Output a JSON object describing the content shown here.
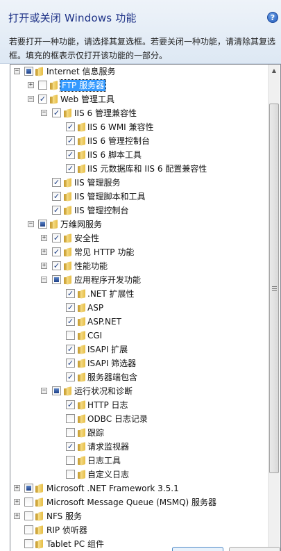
{
  "window": {
    "title": "打开或关闭 Windows 功能",
    "help_glyph": "?",
    "description": "若要打开一种功能，请选择其复选框。若要关闭一种功能，请清除其复选框。填充的框表示仅打开该功能的一部分。"
  },
  "glyphs": {
    "collapse": "−",
    "expand": "+",
    "check": "✓",
    "scroll_up": "▲"
  },
  "tree": {
    "items": [
      {
        "label": "Internet 信息服务",
        "state": "partial",
        "expander": "collapse"
      },
      {
        "label": "FTP 服务器",
        "state": "unchecked",
        "expander": "expand"
      },
      {
        "label": "Web 管理工具",
        "state": "checked",
        "expander": "collapse"
      },
      {
        "label": "IIS 6 管理兼容性",
        "state": "checked",
        "expander": "collapse"
      },
      {
        "label": "IIS 6 WMI 兼容性",
        "state": "checked"
      },
      {
        "label": "IIS 6 管理控制台",
        "state": "checked"
      },
      {
        "label": "IIS 6 脚本工具",
        "state": "checked"
      },
      {
        "label": "IIS 元数据库和 IIS 6 配置兼容性",
        "state": "checked"
      },
      {
        "label": "IIS 管理服务",
        "state": "checked"
      },
      {
        "label": "IIS 管理脚本和工具",
        "state": "checked"
      },
      {
        "label": "IIS 管理控制台",
        "state": "checked"
      },
      {
        "label": "万维网服务",
        "state": "partial",
        "expander": "collapse"
      },
      {
        "label": "安全性",
        "state": "checked",
        "expander": "expand"
      },
      {
        "label": "常见 HTTP 功能",
        "state": "checked",
        "expander": "expand"
      },
      {
        "label": "性能功能",
        "state": "checked",
        "expander": "expand"
      },
      {
        "label": "应用程序开发功能",
        "state": "partial",
        "expander": "collapse"
      },
      {
        "label": ".NET 扩展性",
        "state": "checked"
      },
      {
        "label": "ASP",
        "state": "checked"
      },
      {
        "label": "ASP.NET",
        "state": "checked"
      },
      {
        "label": "CGI",
        "state": "unchecked"
      },
      {
        "label": "ISAPI 扩展",
        "state": "checked"
      },
      {
        "label": "ISAPI 筛选器",
        "state": "checked"
      },
      {
        "label": "服务器端包含",
        "state": "checked"
      },
      {
        "label": "运行状况和诊断",
        "state": "partial",
        "expander": "collapse"
      },
      {
        "label": "HTTP 日志",
        "state": "checked"
      },
      {
        "label": "ODBC 日志记录",
        "state": "unchecked"
      },
      {
        "label": "跟踪",
        "state": "unchecked"
      },
      {
        "label": "请求监视器",
        "state": "checked"
      },
      {
        "label": "日志工具",
        "state": "unchecked"
      },
      {
        "label": "自定义日志",
        "state": "unchecked"
      },
      {
        "label": "Microsoft .NET Framework 3.5.1",
        "state": "partial",
        "expander": "expand"
      },
      {
        "label": "Microsoft Message Queue (MSMQ) 服务器",
        "state": "unchecked",
        "expander": "expand"
      },
      {
        "label": "NFS 服务",
        "state": "unchecked",
        "expander": "expand"
      },
      {
        "label": "RIP 侦听器",
        "state": "unchecked"
      },
      {
        "label": "Tablet PC 组件",
        "state": "unchecked"
      }
    ]
  }
}
